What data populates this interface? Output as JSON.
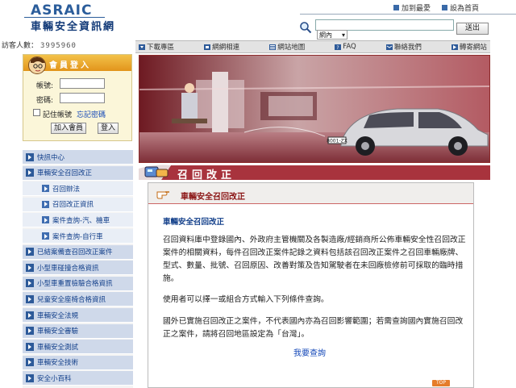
{
  "header": {
    "logo_en": "ASRAIC",
    "logo_zh": "車輛安全資訊網",
    "links": {
      "favorite": "加到最愛",
      "homepage": "設為首頁"
    },
    "search": {
      "placeholder": "",
      "scope": "網內",
      "button": "送出"
    }
  },
  "visitor": {
    "label": "訪客人數：",
    "count": "3995960"
  },
  "navbar": {
    "items": [
      "下載專區",
      "網網相連",
      "網站地圖",
      "FAQ",
      "聯絡我們",
      "轉寄網站"
    ]
  },
  "login": {
    "title": "會員登入",
    "account_label": "帳號:",
    "password_label": "密碼:",
    "remember_label": "記住帳號",
    "forgot_label": "忘記密碼",
    "join_button": "加入會員",
    "login_button": "登入"
  },
  "menu": [
    {
      "label": "快訊中心",
      "type": "main"
    },
    {
      "label": "車輛安全召回改正",
      "type": "main"
    },
    {
      "label": "召回辦法",
      "type": "sub"
    },
    {
      "label": "召回改正資訊",
      "type": "sub"
    },
    {
      "label": "案件查詢-汽、機車",
      "type": "sub"
    },
    {
      "label": "案件查詢-自行車",
      "type": "sub"
    },
    {
      "label": "已結案備查召回改正案件",
      "type": "main"
    },
    {
      "label": "小型車碰撞合格資訊",
      "type": "main"
    },
    {
      "label": "小型車重置檢驗合格資訊",
      "type": "main"
    },
    {
      "label": "兒童安全座椅合格資訊",
      "type": "main"
    },
    {
      "label": "車輛安全法規",
      "type": "main"
    },
    {
      "label": "車輛安全審驗",
      "type": "main"
    },
    {
      "label": "車輛安全測試",
      "type": "main"
    },
    {
      "label": "車輛安全技術",
      "type": "main"
    },
    {
      "label": "安全小百科",
      "type": "main"
    }
  ],
  "banner": {
    "plate": "8001-ZX"
  },
  "section": {
    "title": "召回改正"
  },
  "content": {
    "panel_title": "車輛安全召回改正",
    "article_title": "車輛安全召回改正",
    "para1": "召回資料庫中登錄國內、外政府主管機關及各製造廠/經銷商所公佈車輛安全性召回改正案件的相關資料，每件召回改正案件記錄之資料包括該召回改正案件之召回車輛廠牌、型式、數量、批號、召回原因、改善對策及告知駕駛者在未回廠檢修前可採取的臨時措施。",
    "para2": "使用者可以擇一或組合方式輸入下列條件查詢。",
    "para3": "國外已實施召回改正之案件，不代表國內亦為召回影響範圍；若需查詢國內實施召回改正之案件，請將召回地區設定為「台灣」。",
    "query_link": "我要查詢",
    "top_label": "TOP"
  },
  "colors": {
    "brand_blue": "#2b5d9b",
    "banner_red": "#a8333d",
    "menu_blue": "#cfd9ea",
    "link_blue": "#1448b8"
  }
}
